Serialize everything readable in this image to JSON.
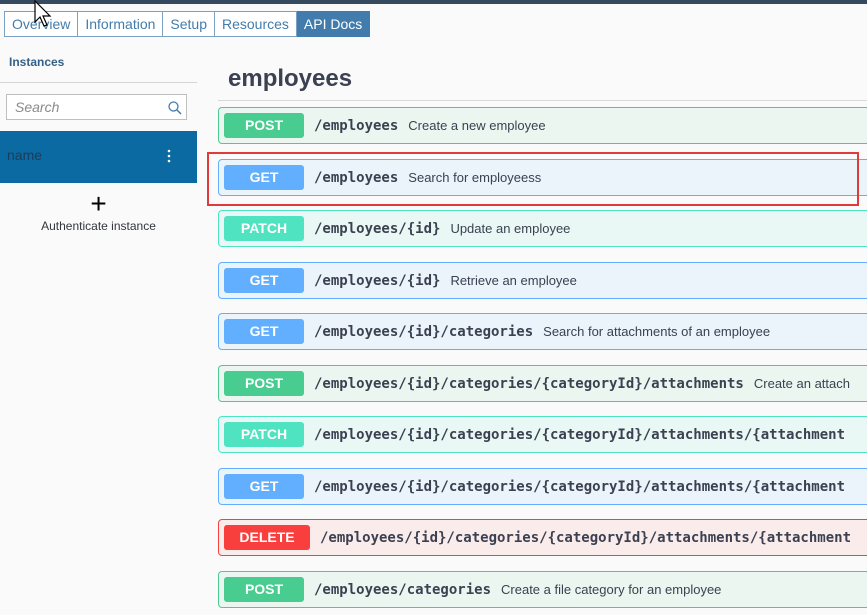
{
  "tabs": [
    {
      "label": "Overview",
      "active": false
    },
    {
      "label": "Information",
      "active": false
    },
    {
      "label": "Setup",
      "active": false
    },
    {
      "label": "Resources",
      "active": false
    },
    {
      "label": "API Docs",
      "active": true
    }
  ],
  "sidebar": {
    "title": "Instances",
    "search_placeholder": "Search",
    "instance_name": "name",
    "add_label": "Authenticate instance"
  },
  "main": {
    "title": "employees",
    "operations": [
      {
        "method": "POST",
        "path": "/employees",
        "summary": "Create a new employee"
      },
      {
        "method": "GET",
        "path": "/employees",
        "summary": "Search for employeess"
      },
      {
        "method": "PATCH",
        "path": "/employees/{id}",
        "summary": "Update an employee"
      },
      {
        "method": "GET",
        "path": "/employees/{id}",
        "summary": "Retrieve an employee"
      },
      {
        "method": "GET",
        "path": "/employees/{id}/categories",
        "summary": "Search for attachments of an employee"
      },
      {
        "method": "POST",
        "path": "/employees/{id}/categories/{categoryId}/attachments",
        "summary": "Create an attach"
      },
      {
        "method": "PATCH",
        "path": "/employees/{id}/categories/{categoryId}/attachments/{attachment",
        "summary": ""
      },
      {
        "method": "GET",
        "path": "/employees/{id}/categories/{categoryId}/attachments/{attachment",
        "summary": ""
      },
      {
        "method": "DELETE",
        "path": "/employees/{id}/categories/{categoryId}/attachments/{attachment",
        "summary": ""
      },
      {
        "method": "POST",
        "path": "/employees/categories",
        "summary": "Create a file category for an employee"
      }
    ]
  },
  "colors": {
    "post": "#49cc90",
    "get": "#61affe",
    "patch": "#50e3c2",
    "delete": "#f93e3e",
    "highlight": "#e03b3b",
    "selected_instance": "#0a6aa1"
  }
}
